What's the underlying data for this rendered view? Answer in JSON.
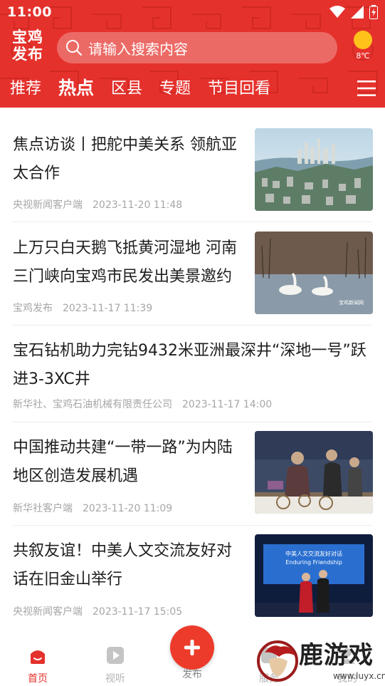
{
  "status": {
    "time": "11:00"
  },
  "header": {
    "logo_line1": "宝鸡",
    "logo_line2": "发布",
    "search_placeholder": "请输入搜索内容",
    "weather_temp": "8℃",
    "tabs": [
      {
        "label": "推荐"
      },
      {
        "label": "热点"
      },
      {
        "label": "区县"
      },
      {
        "label": "专题"
      },
      {
        "label": "节目回看"
      }
    ],
    "active_tab": "热点"
  },
  "news": [
    {
      "title_line1": "焦点访谈丨把舵中美关系 领航亚",
      "title_line2": "太合作",
      "source": "央视新闻客户端",
      "time": "2023-11-20 11:48",
      "thumb": "city-aerial"
    },
    {
      "title_line1": "上万只白天鹅飞抵黄河湿地 河南",
      "title_line2": "三门峡向宝鸡市民发出美景邀约",
      "source": "宝鸡发布",
      "time": "2023-11-17 11:39",
      "thumb": "swans",
      "thumb_caption": "宝鸡新闻网"
    },
    {
      "title_line1": "宝石钻机助力完钻9432米亚洲最深井“深地一号”跃",
      "title_line2": "进3-3XC井",
      "source": "新华社、宝鸡石油机械有限责任公司",
      "time": "2023-11-17 14:00",
      "thumb": null
    },
    {
      "title_line1": "中国推动共建“一带一路”为内陆",
      "title_line2": "地区创造发展机遇",
      "source": "新华社客户端",
      "time": "2023-11-20 11:09",
      "thumb": "expo"
    },
    {
      "title_line1": "共叙友谊！中美人文交流友好对",
      "title_line2": "话在旧金山举行",
      "source": "央视新闻客户端",
      "time": "2023-11-17 15:05",
      "thumb": "stage",
      "screen_cn": "中美人文交流友好对话",
      "screen_en": "Enduring Friendship"
    }
  ],
  "bottom_nav": {
    "home": "首页",
    "video": "视听",
    "publish": "发布",
    "service": "服务",
    "mine": "我的"
  },
  "watermark": {
    "text": "鹿游戏",
    "url": "www.luyx.cn"
  },
  "colors": {
    "brand_red": "#e5312c",
    "muted": "#a6a6a6"
  }
}
